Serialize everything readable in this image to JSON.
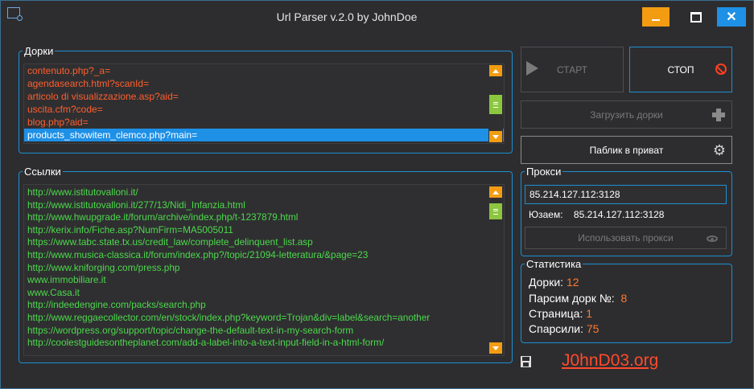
{
  "window": {
    "title": "Url Parser v.2.0 by JohnDoe",
    "close_label": "✕"
  },
  "dorks": {
    "legend": "Дорки",
    "items": [
      "contenuto.php?_a=",
      "agendasearch.html?scanId=",
      "articolo di visualizzazione.asp?aid=",
      "uscita.cfm?code=",
      "blog.php?aid=",
      "products_showitem_clemco.php?main="
    ],
    "selected_index": 5
  },
  "links": {
    "legend": "Ссылки",
    "items": [
      "http://www.istitutovalloni.it/",
      "http://www.istitutovalloni.it/277/13/Nidi_Infanzia.html",
      "http://www.hwupgrade.it/forum/archive/index.php/t-1237879.html",
      "http://kerix.info/Fiche.asp?NumFirm=MA5005011",
      "https://www.tabc.state.tx.us/credit_law/complete_delinquent_list.asp",
      "http://www.musica-classica.it/forum/index.php?/topic/21094-letteratura/&page=23",
      "http://www.kniforging.com/press.php",
      "www.immobiliare.it",
      "www.Casa.it",
      "http://indeedengine.com/packs/search.php",
      "http://www.reggaecollector.com/en/stock/index.php?keyword=Trojan&div=label&search=another",
      "https://wordpress.org/support/topic/change-the-default-text-in-my-search-form",
      "http://coolestguidesontheplanet.com/add-a-label-into-a-text-input-field-in-a-html-form/"
    ]
  },
  "buttons": {
    "start": "СТАРТ",
    "stop": "СТОП",
    "load_dorks": "Загрузить дорки",
    "public_to_private": "Паблик в приват",
    "use_proxy": "Использовать прокси"
  },
  "proxy": {
    "legend": "Прокси",
    "input_value": "85.214.127.112:3128",
    "using_label": "Юзаем:",
    "using_value": "85.214.127.112:3128"
  },
  "stats": {
    "legend": "Статистика",
    "dorks_label": "Дорки:",
    "dorks_value": "12",
    "parsing_label": "Парсим дорк №:",
    "parsing_value": "8",
    "page_label": "Страница:",
    "page_value": "1",
    "parsed_label": "Спарсили:",
    "parsed_value": "75"
  },
  "footer": {
    "site": "J0hnD03.org"
  },
  "colors": {
    "accent": "#1e8fd0",
    "orange": "#f39c12",
    "dork_text": "#ff5f2e",
    "link_text": "#4cd94c",
    "stat_value": "#ff7a2e"
  }
}
